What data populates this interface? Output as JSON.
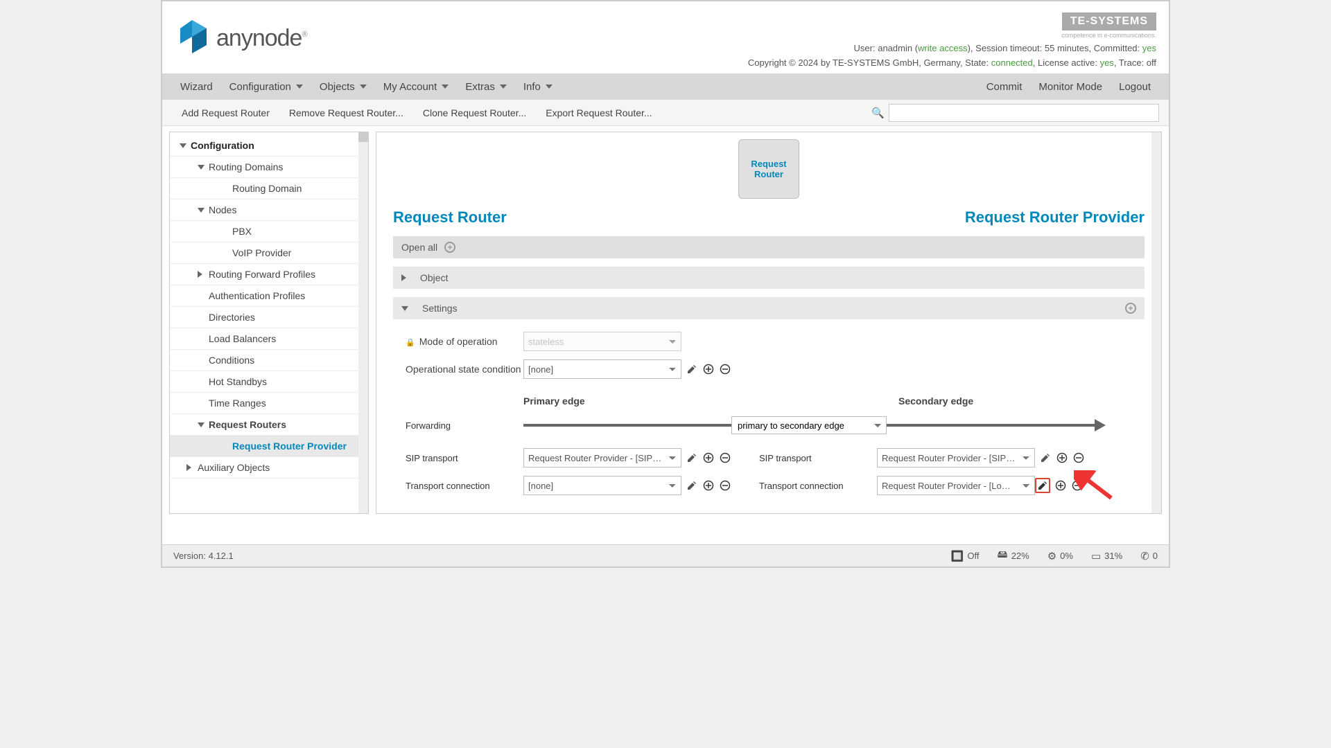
{
  "header": {
    "brand": "anynode",
    "te_brand": "TE-SYSTEMS",
    "te_tag": "competence in e-communications.",
    "user_prefix": "User: ",
    "user": "anadmin",
    "access": "write access",
    "session_label": ", Session timeout: ",
    "session": "55 minutes",
    "committed_label": ", Committed: ",
    "committed": "yes",
    "copyright": "Copyright © 2024 by TE-SYSTEMS GmbH, Germany, State: ",
    "state": "connected",
    "license_label": ", License active: ",
    "license": "yes",
    "trace_label": ", Trace: ",
    "trace": "off"
  },
  "nav": {
    "wizard": "Wizard",
    "configuration": "Configuration",
    "objects": "Objects",
    "account": "My Account",
    "extras": "Extras",
    "info": "Info",
    "commit": "Commit",
    "monitor": "Monitor Mode",
    "logout": "Logout"
  },
  "subnav": {
    "add": "Add Request Router",
    "remove": "Remove Request Router...",
    "clone": "Clone Request Router...",
    "export": "Export Request Router..."
  },
  "tree": {
    "root": "Configuration",
    "routing_domains": "Routing Domains",
    "routing_domain": "Routing Domain",
    "nodes": "Nodes",
    "pbx": "PBX",
    "voip": "VoIP Provider",
    "rfp": "Routing Forward Profiles",
    "auth": "Authentication Profiles",
    "dirs": "Directories",
    "lb": "Load Balancers",
    "cond": "Conditions",
    "hs": "Hot Standbys",
    "tr": "Time Ranges",
    "rr": "Request Routers",
    "rrp": "Request Router Provider",
    "aux": "Auxiliary Objects"
  },
  "main": {
    "node_label": "Request Router",
    "title_left": "Request Router",
    "title_right": "Request Router Provider",
    "open_all": "Open all",
    "object": "Object",
    "settings": "Settings",
    "mode_label": "Mode of operation",
    "mode_value": "stateless",
    "osc_label": "Operational state condition",
    "osc_value": "[none]",
    "primary": "Primary edge",
    "secondary": "Secondary edge",
    "forwarding": "Forwarding",
    "fwd_value": "primary to secondary edge",
    "sip_label": "SIP transport",
    "sip_p_value": "Request Router Provider - [SIP…",
    "sip_s_value": "Request Router Provider - [SIP…",
    "tc_label": "Transport connection",
    "tc_p_value": "[none]",
    "tc_s_value": "Request Router Provider - [Lo…"
  },
  "footer": {
    "version": "Version: 4.12.1",
    "power": "Off",
    "disk": "22%",
    "cpu": "0%",
    "mem": "31%",
    "calls": "0"
  }
}
